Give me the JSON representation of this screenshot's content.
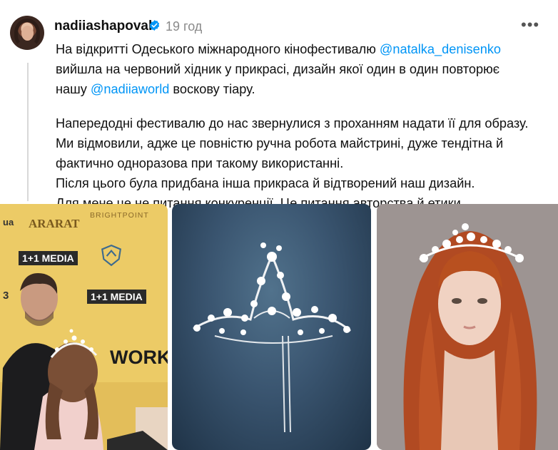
{
  "post": {
    "username": "nadiiashapoval",
    "verified": true,
    "time": "19 год",
    "more_icon": "ellipsis-icon",
    "text": {
      "line1_pre": "На відкритті Одеського міжнародного кінофестивалю ",
      "mention1": "@natalka_denisenko",
      "line2": "вийшла на червоний хідник у прикрасі, дизайн якої один в один повторює",
      "line3_pre": "нашу ",
      "mention2": "@nadiiaworld",
      "line3_post": " воскову тіару.",
      "p2_line1": "Напередодні фестивалю до нас звернулися з проханням надати її для образу.",
      "p2_line2": "Ми відмовили, адже це повністю ручна робота майстрині, дуже тендітна й",
      "p2_line3": "фактично одноразова при такому використанні.",
      "p2_line4": "Після цього була придбана інша прикраса й відтворений наш дизайн.",
      "p2_line5": "Для мене це не питання конкуренції. Це питання авторства й етики."
    }
  },
  "media": {
    "image1_logos": {
      "ararat": "ARARAT",
      "brightpoint": "BRIGHTPOINT",
      "media1": "1+1 MEDIA",
      "media2": "1+1 MEDIA",
      "work": "WORK",
      "left_edge": "ua",
      "left_edge2": "3"
    }
  },
  "colors": {
    "mention": "#0095f6",
    "verified": "#0095f6",
    "text": "#101010",
    "muted": "#8a8a8a"
  }
}
